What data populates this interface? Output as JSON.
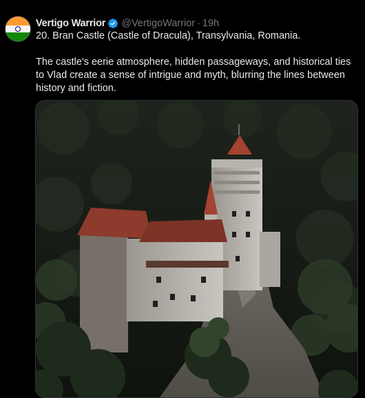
{
  "tweet": {
    "author_name": "Vertigo Warrior",
    "handle": "@VertigoWarrior",
    "separator": "·",
    "timestamp": "19h",
    "text_line1": "20. Bran Castle (Castle of Dracula), Transylvania, Romania.",
    "text_line2": "The castle's eerie atmosphere, hidden passageways, and historical ties to Vlad create a sense of intrigue and myth, blurring the lines between history and fiction.",
    "avatar_icon": "india-flag-avatar",
    "verified_icon": "verified-badge-icon",
    "media_description_icon": "castle-photo"
  },
  "colors": {
    "background": "#000000",
    "text_primary": "#e7e9ea",
    "text_secondary": "#71767b",
    "verified_blue": "#1d9bf0",
    "border": "#2f3336"
  }
}
